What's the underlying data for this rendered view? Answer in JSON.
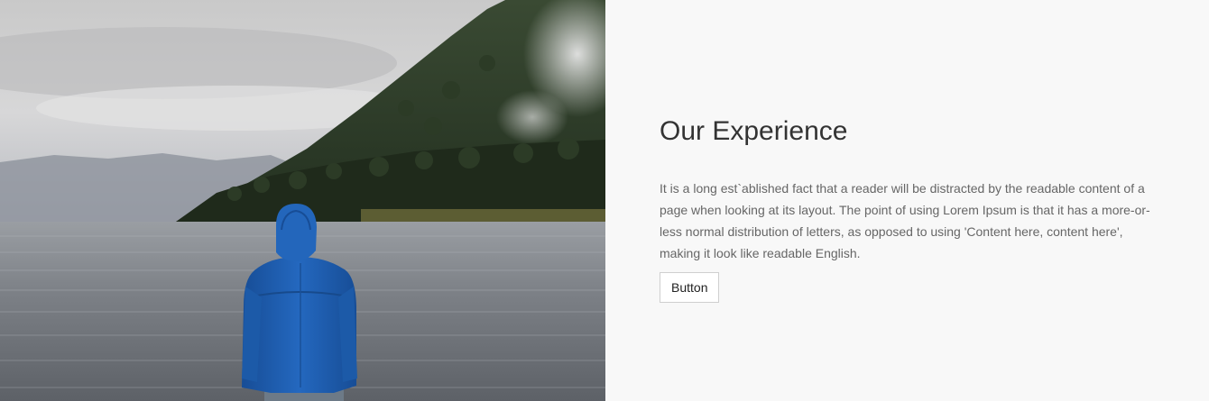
{
  "hero_image": {
    "subject": "person-in-blue-jacket-by-lake"
  },
  "content": {
    "heading": "Our Experience",
    "paragraph": "It is a long est`ablished fact that a reader will be distracted by the readable content of a page when looking at its layout. The point of using Lorem Ipsum is that it has a more-or-less normal distribution of letters, as opposed to using 'Content here, content here', making it look like readable English.",
    "button_label": "Button"
  },
  "colors": {
    "background": "#f8f8f8",
    "heading": "#333333",
    "text": "#666666",
    "jacket": "#1e5fb0"
  }
}
